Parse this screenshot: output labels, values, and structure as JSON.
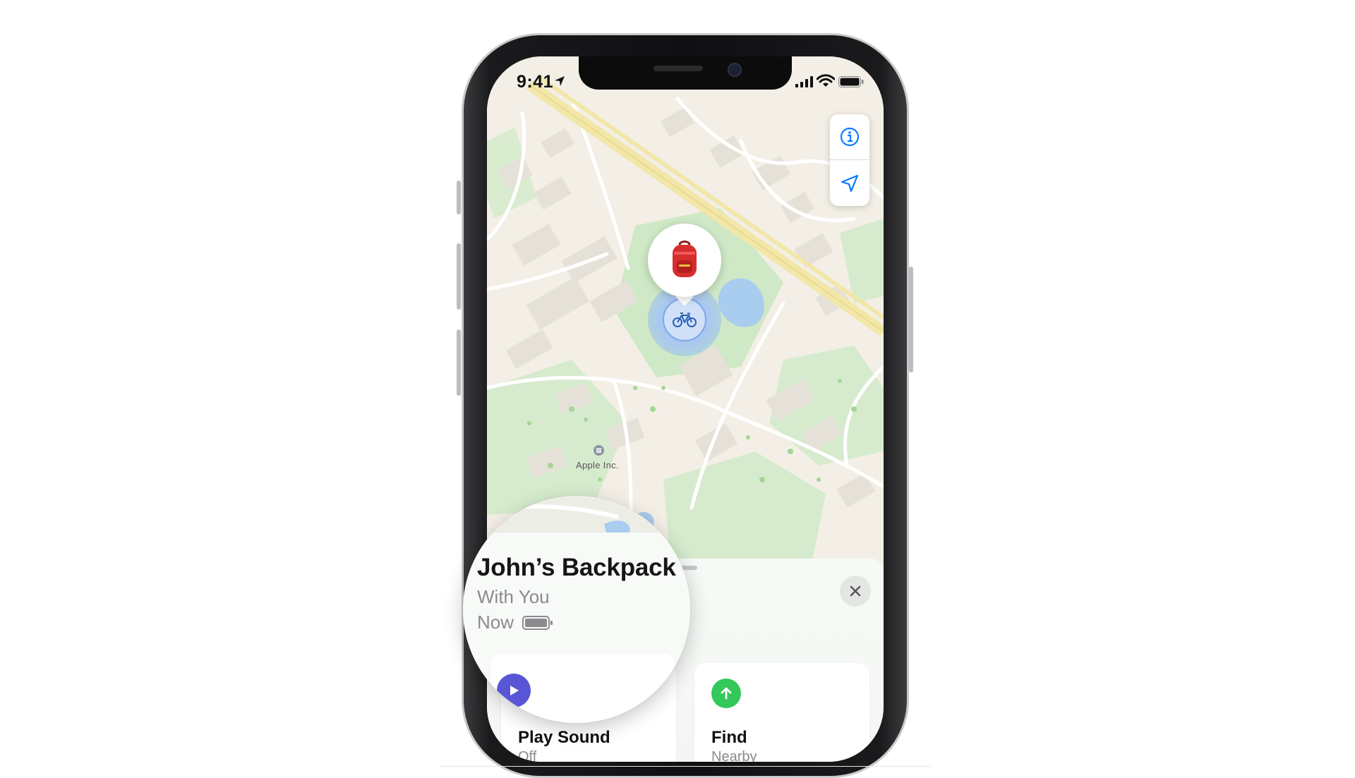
{
  "status_bar": {
    "time": "9:41"
  },
  "map": {
    "poi_label": "Apple Inc.",
    "info_button_icon": "info-circle-icon",
    "location_button_icon": "location-arrow-icon",
    "item_emoji": "🎒",
    "device_icon": "bicycle-icon"
  },
  "item": {
    "name": "John’s Backpack",
    "status": "With You",
    "time": "Now"
  },
  "actions": [
    {
      "label": "Play Sound",
      "sub": "Off",
      "icon": "play-icon",
      "color": "#5856d6"
    },
    {
      "label": "Find",
      "sub": "Nearby",
      "icon": "arrow-up-icon",
      "color": "#34c759"
    }
  ],
  "colors": {
    "accent_blue": "#0a7aff",
    "road_yellow": "#f2e7a8",
    "park_green": "#cfe8c6",
    "water": "#a9cdef"
  }
}
